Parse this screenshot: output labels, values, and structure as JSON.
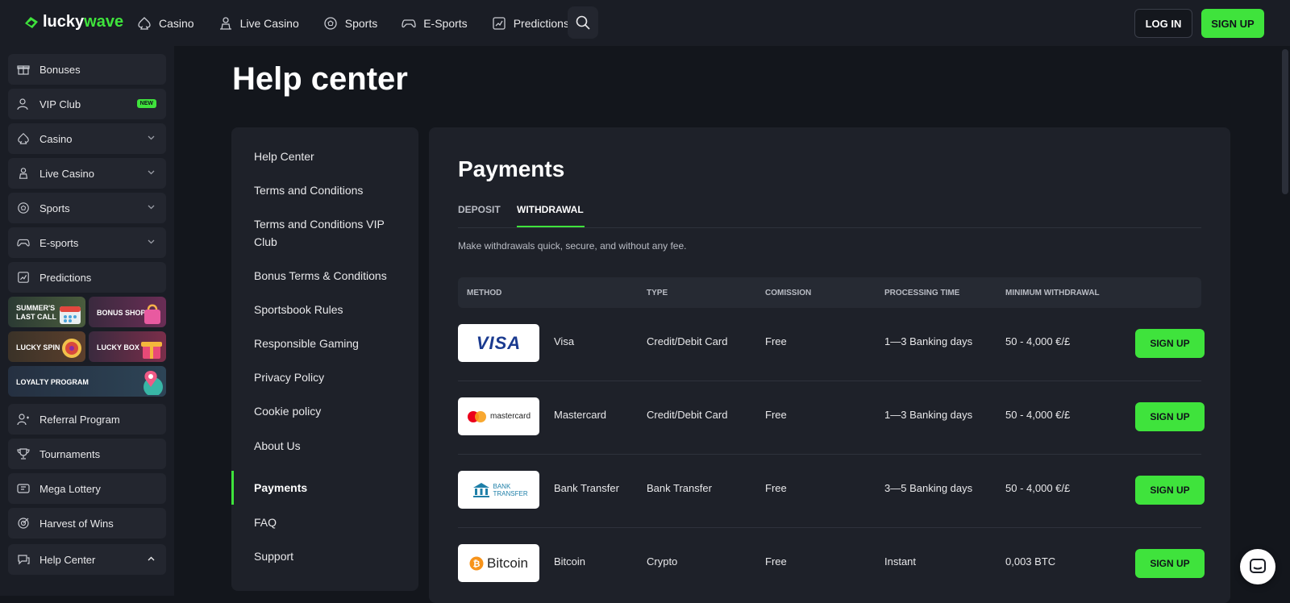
{
  "brand": {
    "part1": "lucky",
    "part2": "wave"
  },
  "nav": [
    {
      "label": "Casino",
      "icon": "spade-icon"
    },
    {
      "label": "Live Casino",
      "icon": "dealer-icon"
    },
    {
      "label": "Sports",
      "icon": "soccer-ball-icon"
    },
    {
      "label": "E-Sports",
      "icon": "gamepad-icon"
    },
    {
      "label": "Predictions",
      "icon": "chart-icon"
    }
  ],
  "header": {
    "login": "LOG IN",
    "signup": "SIGN UP"
  },
  "sidebar": {
    "items": [
      {
        "label": "Bonuses",
        "icon": "gift-icon"
      },
      {
        "label": "VIP Club",
        "icon": "vip-user-icon",
        "badge": "NEW"
      },
      {
        "label": "Casino",
        "icon": "spade-icon"
      },
      {
        "label": "Live Casino",
        "icon": "dealer-icon"
      },
      {
        "label": "Sports",
        "icon": "soccer-ball-icon"
      },
      {
        "label": "E-sports",
        "icon": "gamepad-icon"
      },
      {
        "label": "Predictions",
        "icon": "chart-icon"
      }
    ],
    "promos": {
      "summer": "SUMMER'S LAST CALL",
      "bonus_shop": "BONUS SHOP",
      "lucky_spin": "LUCKY SPIN",
      "lucky_box": "LUCKY BOX",
      "loyalty": "LOYALTY PROGRAM"
    },
    "items2": [
      {
        "label": "Referral Program",
        "icon": "referral-icon"
      },
      {
        "label": "Tournaments",
        "icon": "trophy-icon"
      },
      {
        "label": "Mega Lottery",
        "icon": "ticket-icon"
      },
      {
        "label": "Harvest of Wins",
        "icon": "target-icon"
      },
      {
        "label": "Help Center",
        "icon": "chat-icon"
      }
    ]
  },
  "page": {
    "title": "Help center"
  },
  "help_nav": [
    "Help Center",
    "Terms and Conditions",
    "Terms and Conditions VIP Club",
    "Bonus Terms & Conditions",
    "Sportsbook Rules",
    "Responsible Gaming",
    "Privacy Policy",
    "Cookie policy",
    "About Us",
    "Payments",
    "FAQ",
    "Support"
  ],
  "payments": {
    "title": "Payments",
    "tabs": [
      "DEPOSIT",
      "WITHDRAWAL"
    ],
    "active_tab": "WITHDRAWAL",
    "subtitle": "Make withdrawals quick, secure, and without any fee.",
    "columns": [
      "METHOD",
      "TYPE",
      "COMISSION",
      "PROCESSING TIME",
      "MINIMUM WITHDRAWAL"
    ],
    "rows": [
      {
        "name": "Visa",
        "logo": "VISA",
        "type": "Credit/Debit Card",
        "commission": "Free",
        "time": "1—3 Banking days",
        "minimum": "50 - 4,000 €/£",
        "button": "SIGN UP"
      },
      {
        "name": "Mastercard",
        "logo": "mastercard",
        "type": "Credit/Debit Card",
        "commission": "Free",
        "time": "1—3 Banking days",
        "minimum": "50 - 4,000 €/£",
        "button": "SIGN UP"
      },
      {
        "name": "Bank Transfer",
        "logo": "BANK TRANSFER",
        "type": "Bank Transfer",
        "commission": "Free",
        "time": "3—5 Banking days",
        "minimum": "50 - 4,000 €/£",
        "button": "SIGN UP"
      },
      {
        "name": "Bitcoin",
        "logo": "Bitcoin",
        "type": "Crypto",
        "commission": "Free",
        "time": "Instant",
        "minimum": "0,003 BTC",
        "button": "SIGN UP"
      }
    ]
  },
  "colors": {
    "accent": "#3fe33c",
    "bg": "#13161c",
    "panel": "#1e2129"
  }
}
